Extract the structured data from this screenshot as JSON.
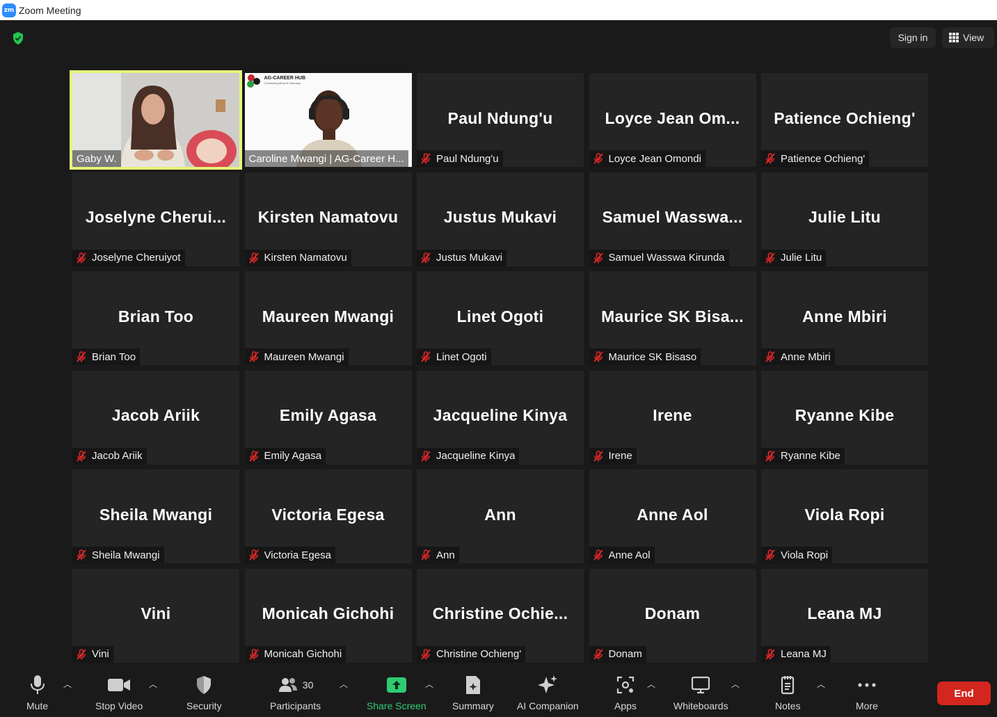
{
  "window": {
    "title": "Zoom Meeting",
    "logo": "zm"
  },
  "topbar": {
    "sign_in": "Sign in",
    "view": "View"
  },
  "tiles": [
    {
      "big": "",
      "tag": "Gaby W.",
      "video": true,
      "active_speaker": true
    },
    {
      "big": "",
      "tag": "Caroline Mwangi | AG-Career H...",
      "video": true,
      "brand": "AG-CAREER HUB",
      "brand_sub": "Connecting Africa & Germany"
    },
    {
      "big": "Paul Ndung'u",
      "tag": "Paul Ndung'u"
    },
    {
      "big": "Loyce Jean Om...",
      "tag": "Loyce Jean Omondi"
    },
    {
      "big": "Patience Ochieng'",
      "tag": "Patience Ochieng'"
    },
    {
      "big": "Joselyne  Cherui...",
      "tag": "Joselyne Cheruiyot"
    },
    {
      "big": "Kirsten Namatovu",
      "tag": "Kirsten Namatovu"
    },
    {
      "big": "Justus Mukavi",
      "tag": "Justus Mukavi"
    },
    {
      "big": "Samuel  Wasswa...",
      "tag": "Samuel Wasswa Kirunda"
    },
    {
      "big": "Julie Litu",
      "tag": "Julie Litu"
    },
    {
      "big": "Brian Too",
      "tag": "Brian Too"
    },
    {
      "big": "Maureen Mwangi",
      "tag": "Maureen Mwangi"
    },
    {
      "big": "Linet Ogoti",
      "tag": "Linet Ogoti"
    },
    {
      "big": "Maurice  SK  Bisa...",
      "tag": "Maurice SK Bisaso"
    },
    {
      "big": "Anne Mbiri",
      "tag": "Anne Mbiri"
    },
    {
      "big": "Jacob Ariik",
      "tag": "Jacob Ariik"
    },
    {
      "big": "Emily Agasa",
      "tag": "Emily Agasa"
    },
    {
      "big": "Jacqueline Kinya",
      "tag": "Jacqueline Kinya"
    },
    {
      "big": "Irene",
      "tag": "Irene"
    },
    {
      "big": "Ryanne Kibe",
      "tag": "Ryanne Kibe"
    },
    {
      "big": "Sheila Mwangi",
      "tag": "Sheila Mwangi"
    },
    {
      "big": "Victoria Egesa",
      "tag": "Victoria Egesa"
    },
    {
      "big": "Ann",
      "tag": "Ann"
    },
    {
      "big": "Anne Aol",
      "tag": "Anne Aol"
    },
    {
      "big": "Viola Ropi",
      "tag": "Viola Ropi"
    },
    {
      "big": "Vini",
      "tag": "Vini"
    },
    {
      "big": "Monicah Gichohi",
      "tag": "Monicah Gichohi"
    },
    {
      "big": "Christine  Ochie...",
      "tag": "Christine Ochieng'"
    },
    {
      "big": "Donam",
      "tag": "Donam"
    },
    {
      "big": "Leana MJ",
      "tag": "Leana MJ"
    }
  ],
  "toolbar": {
    "mute": "Mute",
    "stop_video": "Stop Video",
    "security": "Security",
    "participants": "Participants",
    "participants_count": "30",
    "share_screen": "Share Screen",
    "summary": "Summary",
    "ai_companion": "AI Companion",
    "apps": "Apps",
    "whiteboards": "Whiteboards",
    "notes": "Notes",
    "more": "More",
    "end": "End"
  },
  "colors": {
    "share_green": "#2ecc71",
    "end_red": "#d2261e",
    "speaker_outline": "#e8f37a",
    "mic_muted_red": "#e02828",
    "shield_green": "#23c552"
  }
}
